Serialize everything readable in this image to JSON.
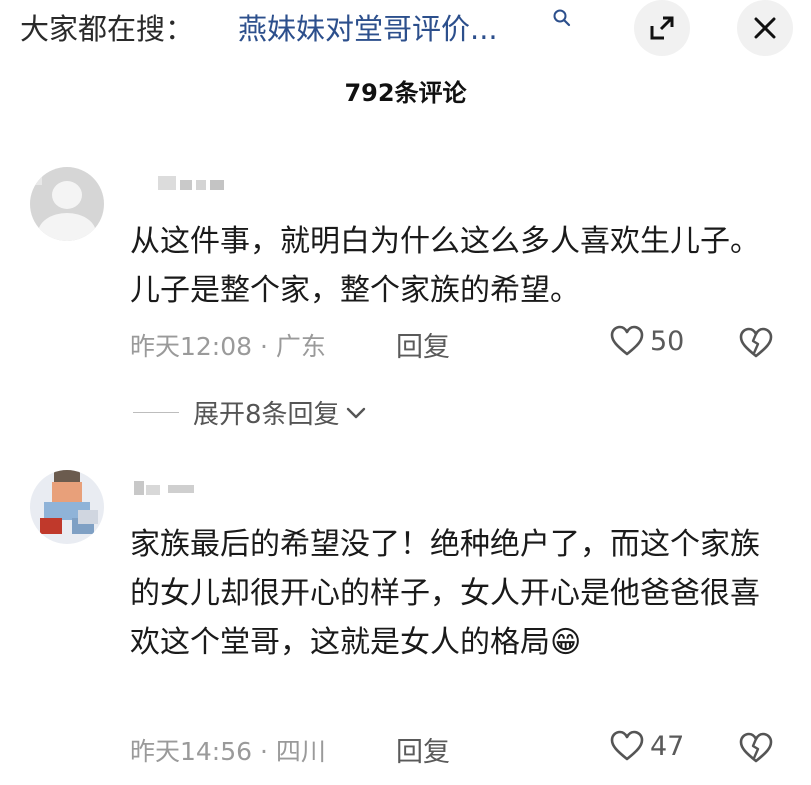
{
  "search": {
    "prefix": "大家都在搜：",
    "query": "燕妹妹对堂哥评价..."
  },
  "header": {
    "comments_count": "792条评论"
  },
  "comments": [
    {
      "text": "从这件事，就明白为什么这么多人喜欢生儿子。儿子是整个家，整个家族的希望。",
      "time": "昨天12:08",
      "location": "广东",
      "reply_label": "回复",
      "likes": "50"
    },
    {
      "text": "家族最后的希望没了！绝种绝户了，而这个家族的女儿却很开心的样子，女人开心是他爸爸很喜欢这个堂哥，这就是女人的格局😁",
      "time": "昨天14:56",
      "location": "四川",
      "reply_label": "回复",
      "likes": "47"
    }
  ],
  "expand_replies": {
    "label": "展开8条回复"
  },
  "icons": {
    "search": "search-icon",
    "expand": "expand-icon",
    "close": "close-icon",
    "like": "heart-outline-icon",
    "dislike": "broken-heart-icon",
    "chevron": "chevron-down-icon"
  },
  "colors": {
    "link_blue": "#2c4f8c",
    "meta_gray": "#9a9a9a"
  }
}
